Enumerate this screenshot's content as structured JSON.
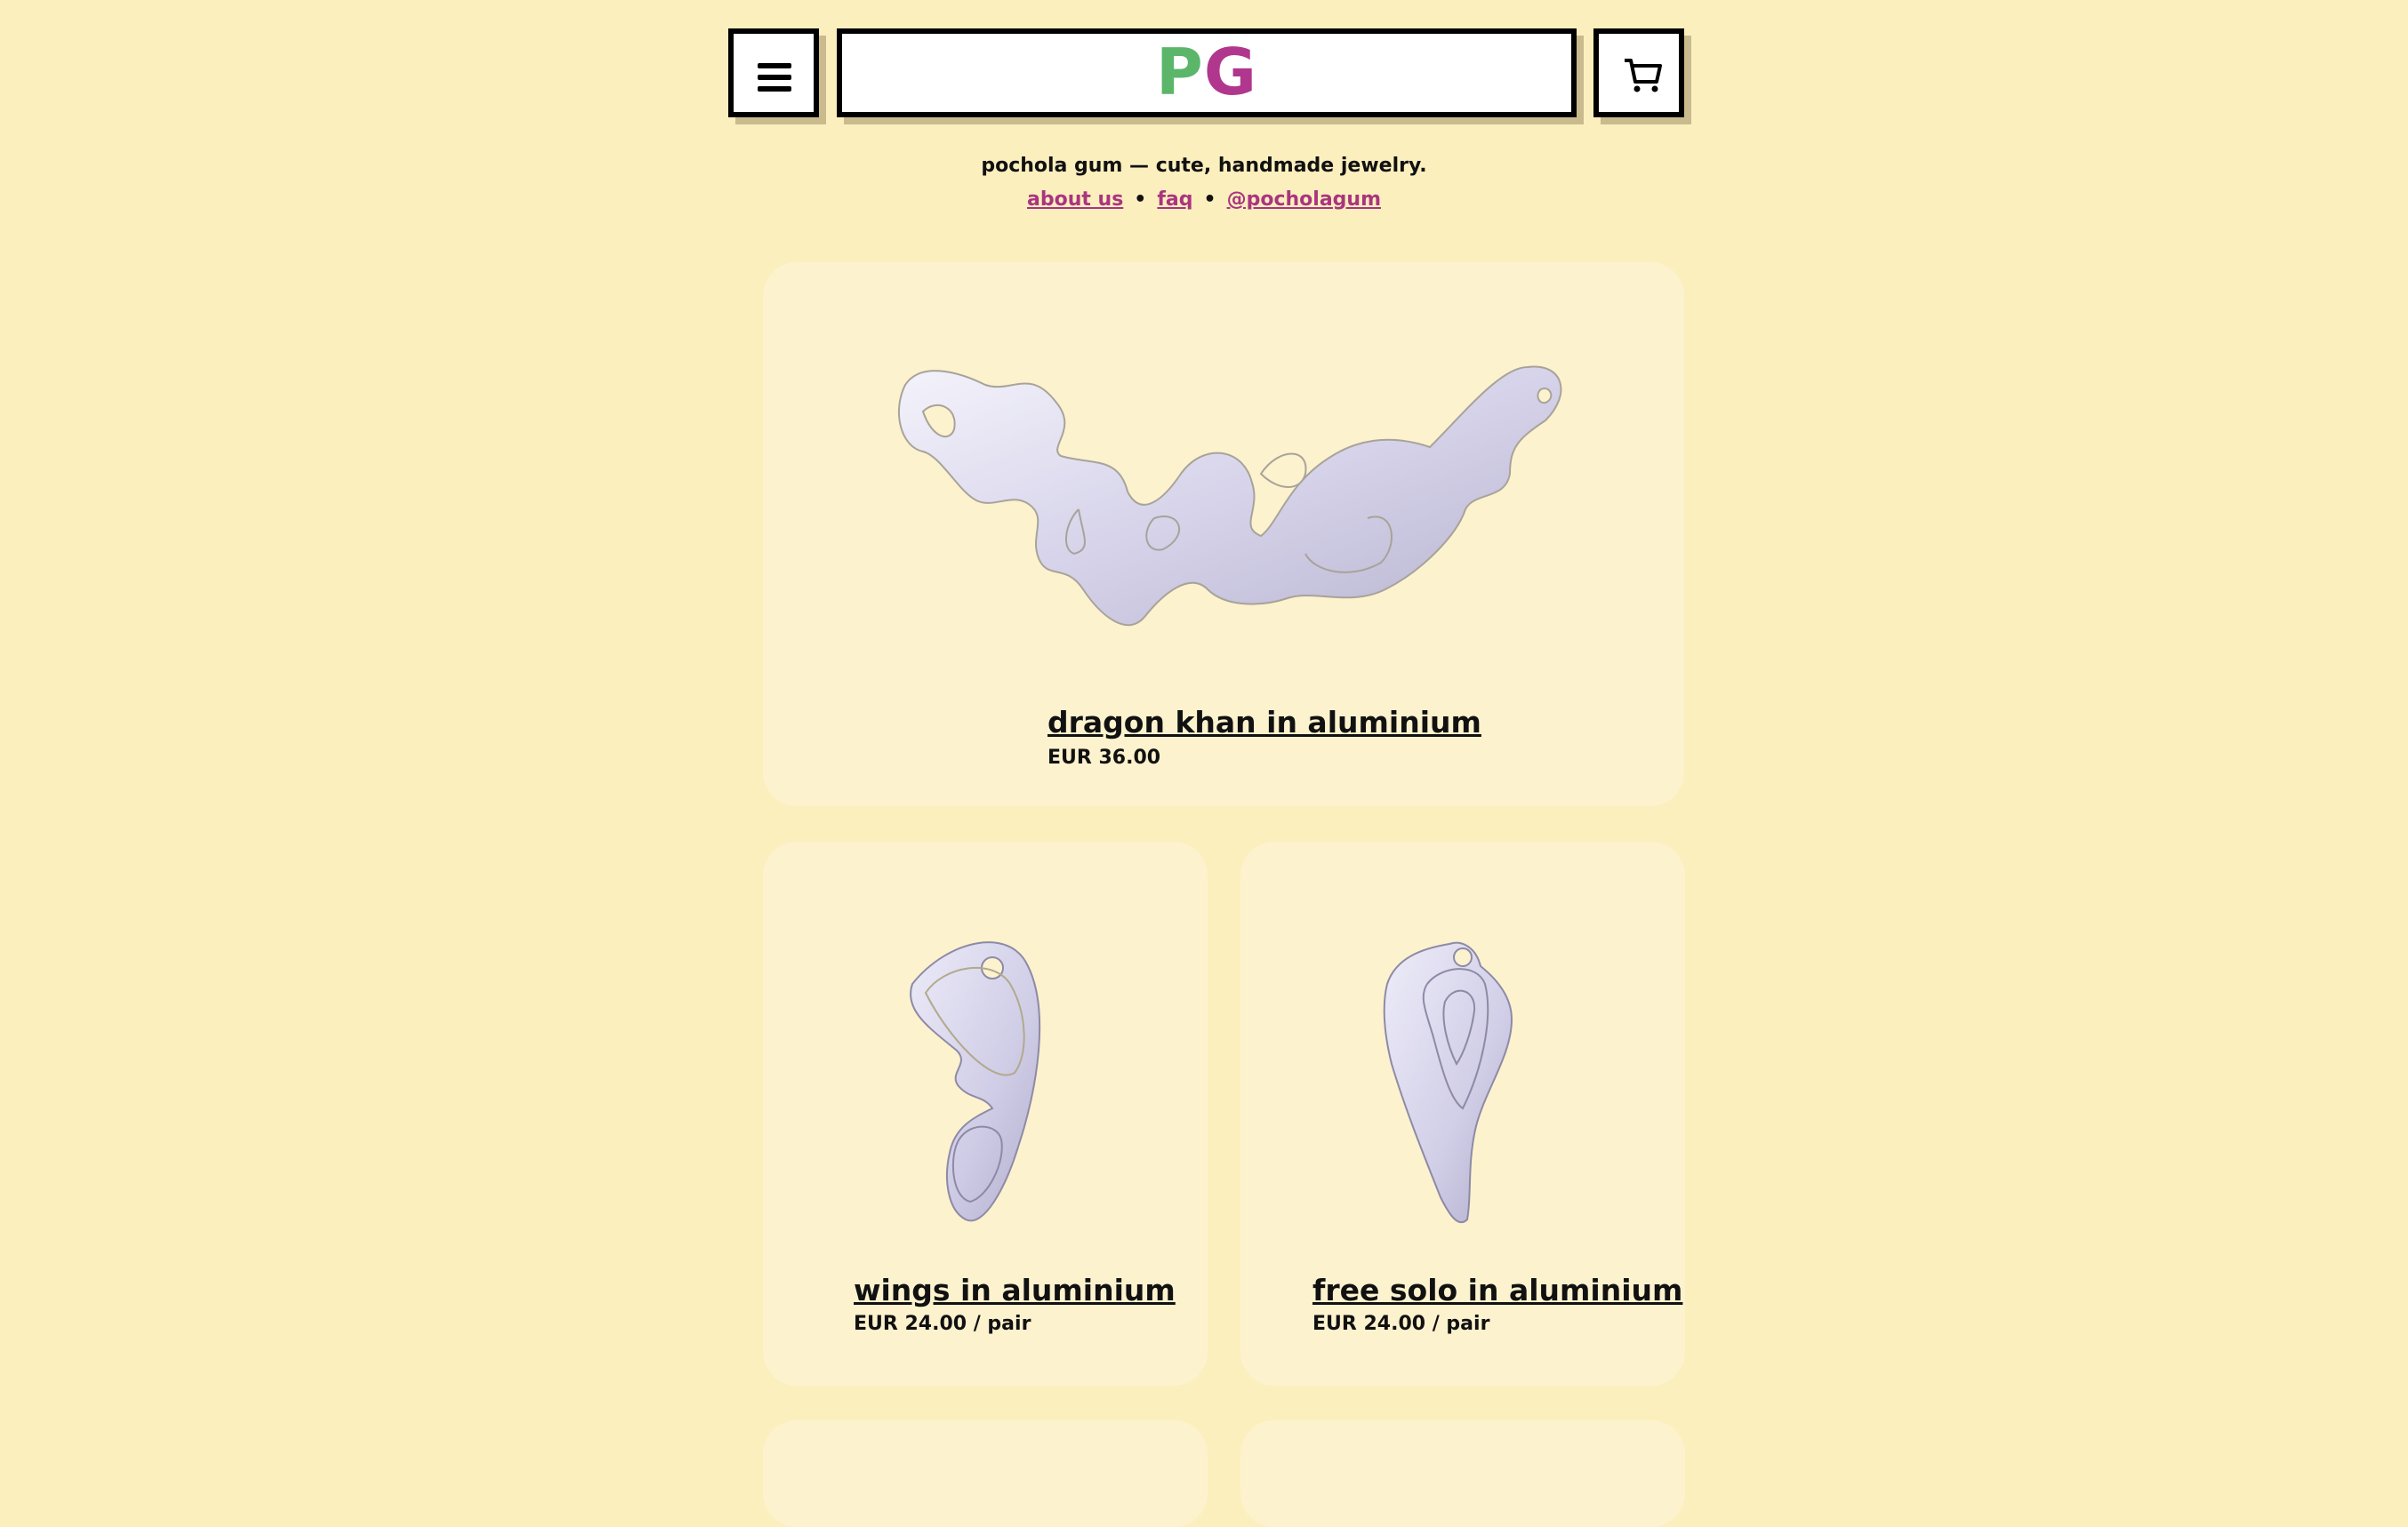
{
  "header": {
    "menu_icon": "hamburger-menu-icon",
    "logo_p": "P",
    "logo_g": "G",
    "cart_icon": "shopping-cart-icon",
    "logo_colors": {
      "p": "#5bb66a",
      "g": "#b0378d"
    }
  },
  "tagline": "pochola gum — cute, handmade jewelry.",
  "links": {
    "about": "about us",
    "faq": "faq",
    "instagram": "@pocholagum",
    "separator": "•",
    "color": "#a9357f"
  },
  "products": [
    {
      "title": "dragon khan in aluminium",
      "price": "EUR 36.00"
    },
    {
      "title": "wings in aluminium",
      "price": "EUR 24.00 / pair"
    },
    {
      "title": "free solo in aluminium",
      "price": "EUR 24.00 / pair"
    }
  ],
  "colors": {
    "background": "#fcefbe",
    "card": "#fcf2ce",
    "metal": "#d8d5ec"
  }
}
